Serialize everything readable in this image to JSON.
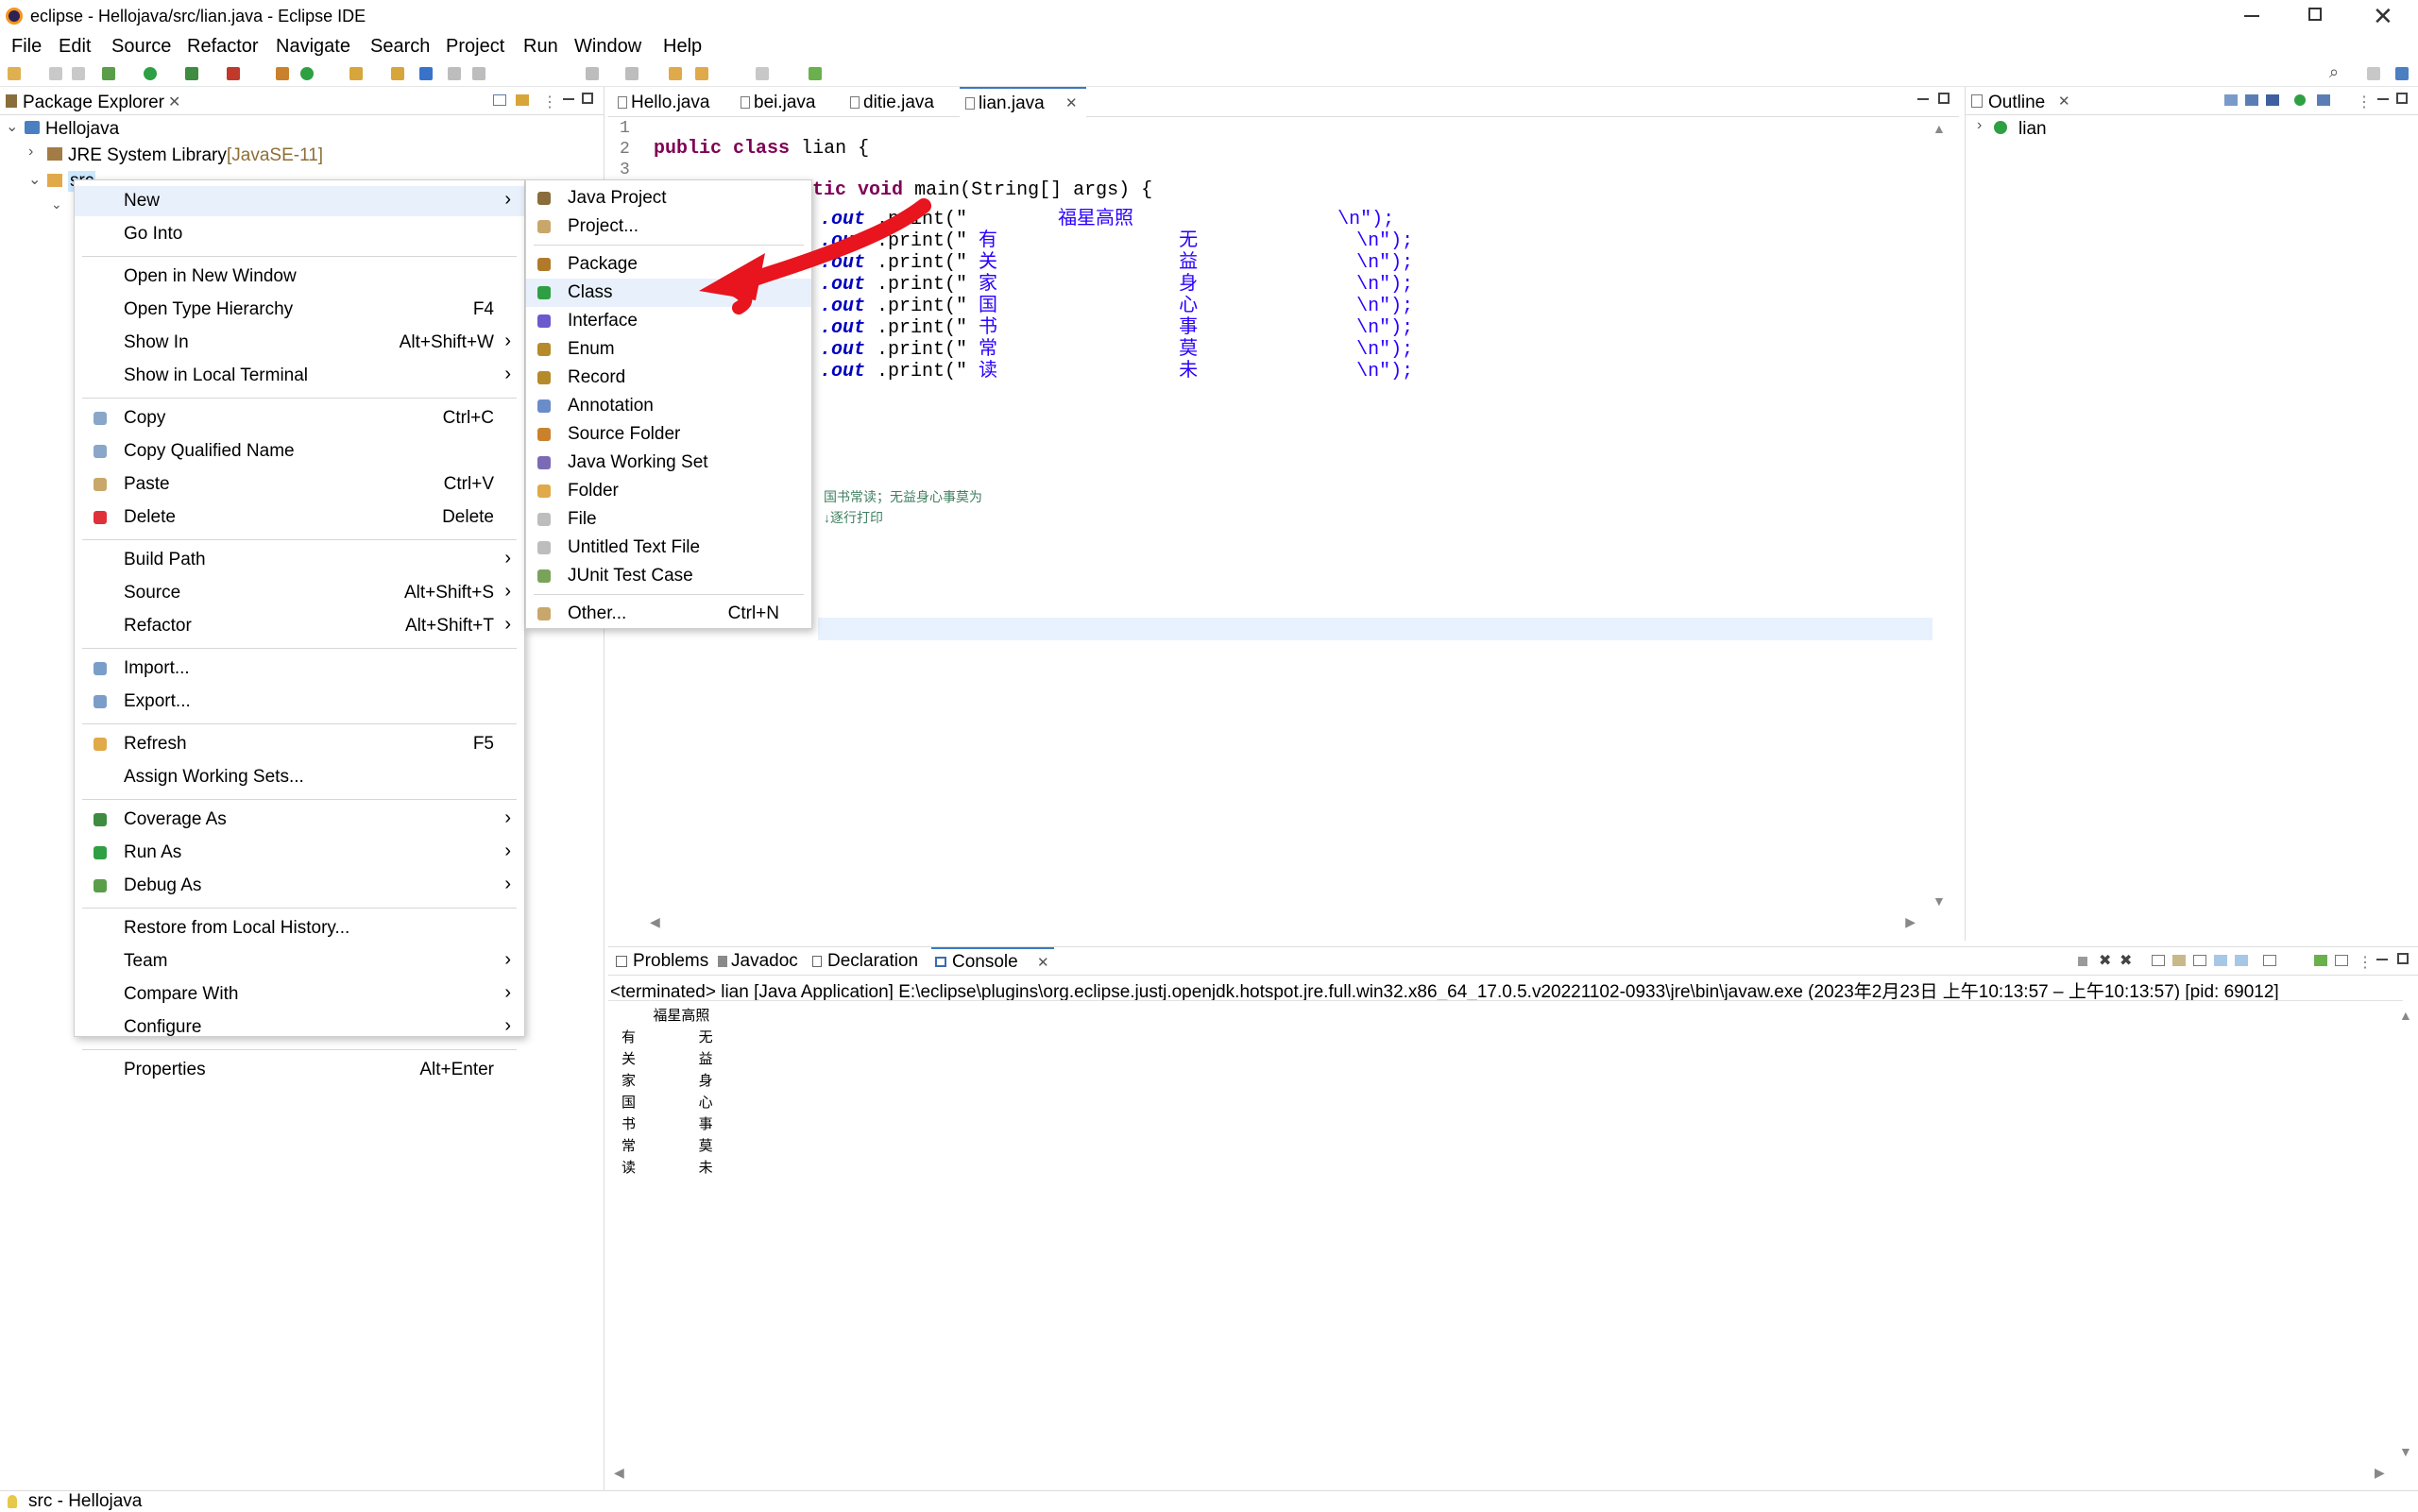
{
  "window": {
    "title": "eclipse - Hellojava/src/lian.java - Eclipse IDE"
  },
  "menubar": [
    "File",
    "Edit",
    "Source",
    "Refactor",
    "Navigate",
    "Search",
    "Project",
    "Run",
    "Window",
    "Help"
  ],
  "package_explorer": {
    "tab": "Package Explorer",
    "tree": {
      "project": "Hellojava",
      "jre": "JRE System Library",
      "jre_version": "[JavaSE-11]",
      "src": "src"
    }
  },
  "editor": {
    "tabs": [
      "Hello.java",
      "bei.java",
      "ditie.java",
      "lian.java"
    ],
    "active_tab": "lian.java",
    "line_numbers": [
      "1",
      "2",
      "3"
    ],
    "line2": {
      "kw1": "public",
      "kw2": "class",
      "name": "lian {"
    },
    "main_sig": {
      "kw1": "tic",
      "kw2": "void",
      "rest": "main(String[] args) {"
    },
    "print_lines": [
      {
        "obj": ".out",
        "call": ".print(\"",
        "mid": "        福星高照                  ",
        "end": "\\n\");"
      },
      {
        "obj": ".out",
        "call": ".print(\"",
        "mid": " 有                无              ",
        "end": "\\n\");"
      },
      {
        "obj": ".out",
        "call": ".print(\"",
        "mid": " 关                益              ",
        "end": "\\n\");"
      },
      {
        "obj": ".out",
        "call": ".print(\"",
        "mid": " 家                身              ",
        "end": "\\n\");"
      },
      {
        "obj": ".out",
        "call": ".print(\"",
        "mid": " 国                心              ",
        "end": "\\n\");"
      },
      {
        "obj": ".out",
        "call": ".print(\"",
        "mid": " 书                事              ",
        "end": "\\n\");"
      },
      {
        "obj": ".out",
        "call": ".print(\"",
        "mid": " 常                莫              ",
        "end": "\\n\");"
      },
      {
        "obj": ".out",
        "call": ".print(\"",
        "mid": " 读                未              ",
        "end": "\\n\");"
      }
    ],
    "comments": [
      "国书常读；无益身心事莫为",
      "↓逐行打印"
    ]
  },
  "outline": {
    "tab": "Outline",
    "item": "lian"
  },
  "context_menu": {
    "items": [
      {
        "label": "New",
        "arrow": "›"
      },
      {
        "label": "Go Into"
      },
      {
        "label": "Open in New Window"
      },
      {
        "label": "Open Type Hierarchy",
        "acc": "F4"
      },
      {
        "label": "Show In",
        "acc": "Alt+Shift+W",
        "arrow": "›"
      },
      {
        "label": "Show in Local Terminal",
        "arrow": "›"
      },
      {
        "label": "Copy",
        "acc": "Ctrl+C"
      },
      {
        "label": "Copy Qualified Name"
      },
      {
        "label": "Paste",
        "acc": "Ctrl+V"
      },
      {
        "label": "Delete",
        "acc": "Delete"
      },
      {
        "label": "Build Path",
        "arrow": "›"
      },
      {
        "label": "Source",
        "acc": "Alt+Shift+S",
        "arrow": "›"
      },
      {
        "label": "Refactor",
        "acc": "Alt+Shift+T",
        "arrow": "›"
      },
      {
        "label": "Import..."
      },
      {
        "label": "Export..."
      },
      {
        "label": "Refresh",
        "acc": "F5"
      },
      {
        "label": "Assign Working Sets..."
      },
      {
        "label": "Coverage As",
        "arrow": "›"
      },
      {
        "label": "Run As",
        "arrow": "›"
      },
      {
        "label": "Debug As",
        "arrow": "›"
      },
      {
        "label": "Restore from Local History..."
      },
      {
        "label": "Team",
        "arrow": "›"
      },
      {
        "label": "Compare With",
        "arrow": "›"
      },
      {
        "label": "Configure",
        "arrow": "›"
      },
      {
        "label": "Properties",
        "acc": "Alt+Enter"
      }
    ]
  },
  "submenu": {
    "items": [
      {
        "label": "Java Project"
      },
      {
        "label": "Project..."
      },
      {
        "label": "Package"
      },
      {
        "label": "Class"
      },
      {
        "label": "Interface"
      },
      {
        "label": "Enum"
      },
      {
        "label": "Record"
      },
      {
        "label": "Annotation"
      },
      {
        "label": "Source Folder"
      },
      {
        "label": "Java Working Set"
      },
      {
        "label": "Folder"
      },
      {
        "label": "File"
      },
      {
        "label": "Untitled Text File"
      },
      {
        "label": "JUnit Test Case"
      },
      {
        "label": "Other...",
        "acc": "Ctrl+N"
      }
    ]
  },
  "bottom": {
    "tabs": [
      "Problems",
      "Javadoc",
      "Declaration",
      "Console"
    ],
    "active_tab": "Console",
    "status": "<terminated> lian [Java Application] E:\\eclipse\\plugins\\org.eclipse.justj.openjdk.hotspot.jre.full.win32.x86_64_17.0.5.v20221102-0933\\jre\\bin\\javaw.exe  (2023年2月23日 上午10:13:57 – 上午10:13:57) [pid: 69012]",
    "console_lines": [
      "        福星高照",
      "有                无",
      "关                益",
      "家                身",
      "国                心",
      "书                事",
      "常                莫",
      "读                未"
    ]
  },
  "statusbar": {
    "text": "src - Hellojava"
  },
  "colors": {
    "accent": "#e8f0fb",
    "arrow": "#e8141e",
    "keyword": "#7f0055",
    "string": "#2a00ff"
  }
}
